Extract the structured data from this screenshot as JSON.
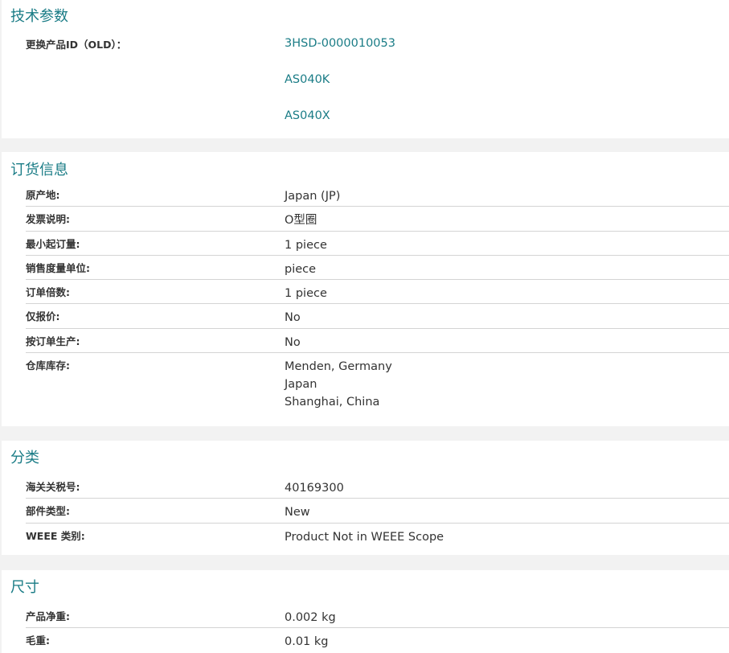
{
  "sections": {
    "tech": {
      "title": "技术参数",
      "replacement_label": "更换产品ID（OLD）：",
      "replacement_links": [
        "3HSD-0000010053",
        "AS040K",
        "AS040X"
      ]
    },
    "order": {
      "title": "订货信息",
      "rows": [
        {
          "label": "原产地:",
          "value": "Japan (JP)"
        },
        {
          "label": "发票说明:",
          "value": "O型圈"
        },
        {
          "label": "最小起订量:",
          "value": "1 piece"
        },
        {
          "label": "销售度量单位:",
          "value": "piece"
        },
        {
          "label": "订单倍数:",
          "value": "1 piece"
        },
        {
          "label": "仅报价:",
          "value": "No"
        },
        {
          "label": "按订单生产:",
          "value": "No"
        }
      ],
      "stock_label": "仓库库存:",
      "stock_values": [
        "Menden, Germany",
        "Japan",
        "Shanghai, China"
      ]
    },
    "classification": {
      "title": "分类",
      "rows": [
        {
          "label": "海关关税号:",
          "value": "40169300"
        },
        {
          "label": "部件类型:",
          "value": "New"
        },
        {
          "label": "WEEE 类别:",
          "value": "Product Not in WEEE Scope"
        }
      ]
    },
    "dimensions": {
      "title": "尺寸",
      "rows": [
        {
          "label": "产品净重:",
          "value": "0.002 kg"
        },
        {
          "label": "毛重:",
          "value": "0.01 kg"
        }
      ]
    }
  },
  "colors": {
    "accent": "#1a7c86",
    "background": "#f2f2f2",
    "card": "#ffffff",
    "divider": "#d4d4d4"
  }
}
